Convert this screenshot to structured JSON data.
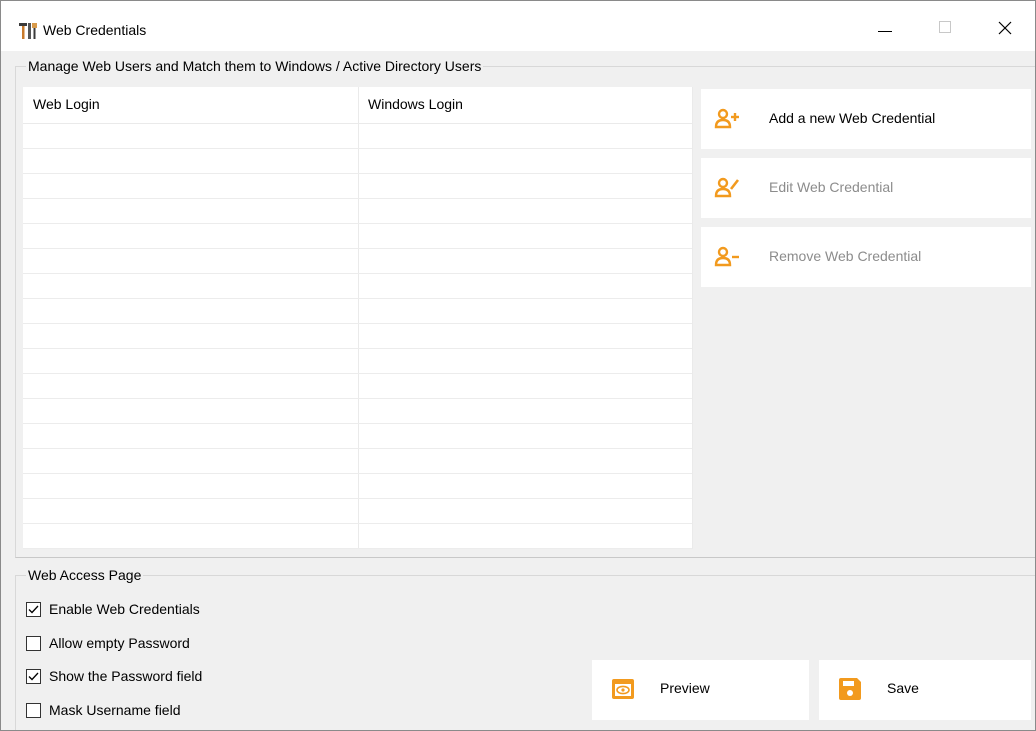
{
  "window": {
    "title": "Web Credentials",
    "icon": "tools-icon"
  },
  "users_group": {
    "legend": "Manage Web Users and Match them to Windows / Active Directory Users",
    "columns": [
      "Web Login",
      "Windows Login"
    ],
    "rows": [
      [
        "",
        ""
      ],
      [
        "",
        ""
      ],
      [
        "",
        ""
      ],
      [
        "",
        ""
      ],
      [
        "",
        ""
      ],
      [
        "",
        ""
      ],
      [
        "",
        ""
      ],
      [
        "",
        ""
      ],
      [
        "",
        ""
      ],
      [
        "",
        ""
      ],
      [
        "",
        ""
      ],
      [
        "",
        ""
      ],
      [
        "",
        ""
      ],
      [
        "",
        ""
      ],
      [
        "",
        ""
      ],
      [
        "",
        ""
      ],
      [
        "",
        ""
      ]
    ]
  },
  "actions": {
    "add": {
      "label": "Add a new Web Credential",
      "enabled": true,
      "icon": "user-add-icon"
    },
    "edit": {
      "label": "Edit Web Credential",
      "enabled": false,
      "icon": "user-edit-icon"
    },
    "remove": {
      "label": "Remove Web Credential",
      "enabled": false,
      "icon": "user-remove-icon"
    }
  },
  "access_group": {
    "legend": "Web Access Page",
    "options": [
      {
        "label": "Enable Web Credentials",
        "checked": true
      },
      {
        "label": "Allow empty Password",
        "checked": false
      },
      {
        "label": "Show the Password field",
        "checked": true
      },
      {
        "label": "Mask Username field",
        "checked": false
      }
    ]
  },
  "buttons": {
    "preview": {
      "label": "Preview",
      "icon": "eye-icon"
    },
    "save": {
      "label": "Save",
      "icon": "floppy-disk-icon"
    }
  },
  "colors": {
    "accent": "#f29a1e",
    "disabled_text": "#8c8c8c",
    "background": "#f0f0f0"
  }
}
